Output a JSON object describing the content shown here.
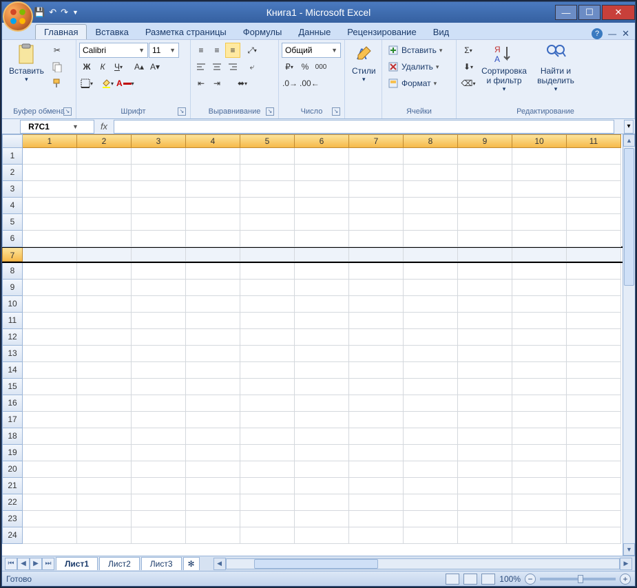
{
  "title": "Книга1 - Microsoft Excel",
  "tabs": {
    "items": [
      "Главная",
      "Вставка",
      "Разметка страницы",
      "Формулы",
      "Данные",
      "Рецензирование",
      "Вид"
    ],
    "active": 0
  },
  "ribbon": {
    "clipboard": {
      "label": "Буфер обмена",
      "paste": "Вставить"
    },
    "font": {
      "label": "Шрифт",
      "name": "Calibri",
      "size": "11",
      "bold": "Ж",
      "italic": "К",
      "underline": "Ч"
    },
    "align": {
      "label": "Выравнивание"
    },
    "number": {
      "label": "Число",
      "format": "Общий"
    },
    "styles": {
      "label": "",
      "btn": "Стили"
    },
    "cells": {
      "label": "Ячейки",
      "insert": "Вставить",
      "delete": "Удалить",
      "format": "Формат"
    },
    "editing": {
      "label": "Редактирование",
      "sort": "Сортировка и фильтр",
      "find": "Найти и выделить"
    }
  },
  "namebox": "R7C1",
  "columns": [
    "1",
    "2",
    "3",
    "4",
    "5",
    "6",
    "7",
    "8",
    "9",
    "10",
    "11"
  ],
  "rows": [
    "1",
    "2",
    "3",
    "4",
    "5",
    "6",
    "7",
    "8",
    "9",
    "10",
    "11",
    "12",
    "13",
    "14",
    "15",
    "16",
    "17",
    "18",
    "19",
    "20",
    "21",
    "22",
    "23",
    "24"
  ],
  "selected_row": 7,
  "sheets": {
    "items": [
      "Лист1",
      "Лист2",
      "Лист3"
    ],
    "active": 0
  },
  "status": {
    "ready": "Готово",
    "zoom": "100%"
  }
}
